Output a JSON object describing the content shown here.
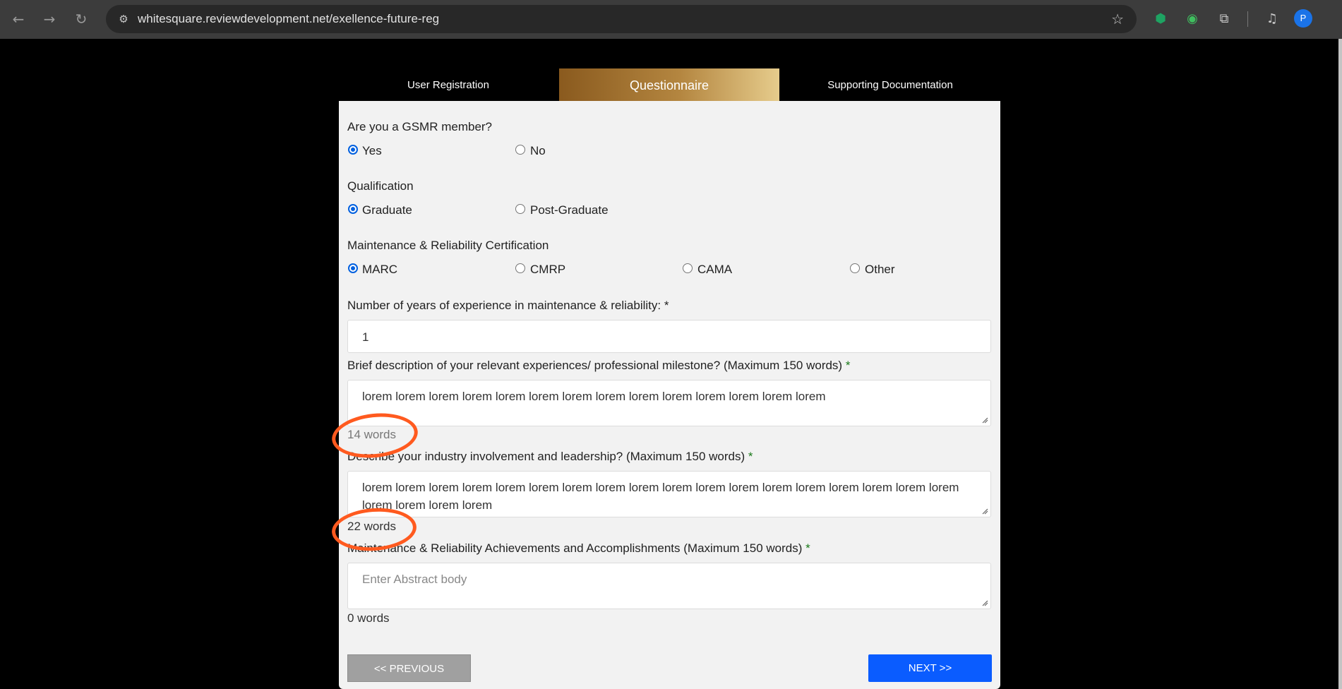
{
  "browser": {
    "url": "whitesquare.reviewdevelopment.net/exellence-future-reg",
    "profile_initial": "P"
  },
  "tabs": [
    {
      "label": "User Registration"
    },
    {
      "label": "Questionnaire"
    },
    {
      "label": "Supporting Documentation"
    }
  ],
  "form": {
    "gsmr": {
      "question": "Are you a GSMR member?",
      "options": [
        "Yes",
        "No"
      ],
      "selected": "Yes"
    },
    "qualification": {
      "question": "Qualification",
      "options": [
        "Graduate",
        "Post-Graduate"
      ],
      "selected": "Graduate"
    },
    "certification": {
      "question": "Maintenance & Reliability Certification",
      "options": [
        "MARC",
        "CMRP",
        "CAMA",
        "Other"
      ],
      "selected": "MARC"
    },
    "experience_years": {
      "label": "Number of years of experience in maintenance & reliability: *",
      "value": "1"
    },
    "brief_description": {
      "label": "Brief description of your relevant experiences/ professional milestone? (Maximum 150 words)",
      "required_mark": "*",
      "value": "lorem lorem lorem lorem lorem lorem lorem lorem lorem lorem lorem lorem lorem lorem",
      "count": "14 words"
    },
    "industry_involvement": {
      "label": "Describe your industry involvement and leadership? (Maximum 150 words)",
      "required_mark": "*",
      "value": "lorem lorem lorem lorem lorem lorem lorem lorem lorem lorem lorem lorem lorem lorem lorem lorem lorem lorem lorem lorem lorem lorem",
      "count": "22 words"
    },
    "achievements": {
      "label": "Maintenance & Reliability Achievements and Accomplishments (Maximum 150 words)",
      "required_mark": "*",
      "placeholder": "Enter Abstract body",
      "count": "0 words"
    }
  },
  "buttons": {
    "previous": "<< PREVIOUS",
    "next": "NEXT >>"
  },
  "colors": {
    "annotation_circle": "#ff5a1f",
    "next_button": "#0a5cff",
    "active_tab": "#b48640"
  }
}
